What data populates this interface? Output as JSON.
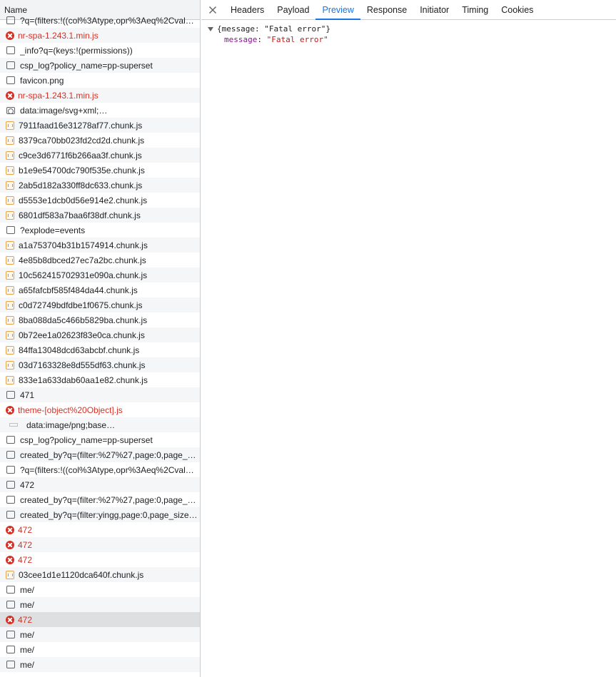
{
  "network": {
    "name_header": "Name",
    "rows": [
      {
        "label": "?q=(filters:!((col%3Atype,opr%3Aeq%2Cval…",
        "icon": "doc",
        "state": "normal"
      },
      {
        "label": "nr-spa-1.243.1.min.js",
        "icon": "err",
        "state": "error"
      },
      {
        "label": "_info?q=(keys:!(permissions))",
        "icon": "doc",
        "state": "normal"
      },
      {
        "label": "csp_log?policy_name=pp-superset",
        "icon": "doc",
        "state": "normal"
      },
      {
        "label": "favicon.png",
        "icon": "doc",
        "state": "normal"
      },
      {
        "label": "nr-spa-1.243.1.min.js",
        "icon": "err",
        "state": "error"
      },
      {
        "label": "data:image/svg+xml;…",
        "icon": "svg",
        "state": "normal"
      },
      {
        "label": "7911faad16e31278af77.chunk.js",
        "icon": "js",
        "state": "normal"
      },
      {
        "label": "8379ca70bb023fd2cd2d.chunk.js",
        "icon": "js",
        "state": "normal"
      },
      {
        "label": "c9ce3d6771f6b266aa3f.chunk.js",
        "icon": "js",
        "state": "normal"
      },
      {
        "label": "b1e9e54700dc790f535e.chunk.js",
        "icon": "js",
        "state": "normal"
      },
      {
        "label": "2ab5d182a330ff8dc633.chunk.js",
        "icon": "js",
        "state": "normal"
      },
      {
        "label": "d5553e1dcb0d56e914e2.chunk.js",
        "icon": "js",
        "state": "normal"
      },
      {
        "label": "6801df583a7baa6f38df.chunk.js",
        "icon": "js",
        "state": "normal"
      },
      {
        "label": "?explode=events",
        "icon": "doc",
        "state": "normal"
      },
      {
        "label": "a1a753704b31b1574914.chunk.js",
        "icon": "js",
        "state": "normal"
      },
      {
        "label": "4e85b8dbced27ec7a2bc.chunk.js",
        "icon": "js",
        "state": "normal"
      },
      {
        "label": "10c562415702931e090a.chunk.js",
        "icon": "js",
        "state": "normal"
      },
      {
        "label": "a65fafcbf585f484da44.chunk.js",
        "icon": "js",
        "state": "normal"
      },
      {
        "label": "c0d72749bdfdbe1f0675.chunk.js",
        "icon": "js",
        "state": "normal"
      },
      {
        "label": "8ba088da5c466b5829ba.chunk.js",
        "icon": "js",
        "state": "normal"
      },
      {
        "label": "0b72ee1a02623f83e0ca.chunk.js",
        "icon": "js",
        "state": "normal"
      },
      {
        "label": "84ffa13048dcd63abcbf.chunk.js",
        "icon": "js",
        "state": "normal"
      },
      {
        "label": "03d7163328e8d555df63.chunk.js",
        "icon": "js",
        "state": "normal"
      },
      {
        "label": "833e1a633dab60aa1e82.chunk.js",
        "icon": "js",
        "state": "normal"
      },
      {
        "label": "471",
        "icon": "doc",
        "state": "normal"
      },
      {
        "label": "theme-[object%20Object].js",
        "icon": "err",
        "state": "error"
      },
      {
        "label": "data:image/png;base…",
        "icon": "img",
        "state": "normal"
      },
      {
        "label": "csp_log?policy_name=pp-superset",
        "icon": "doc",
        "state": "normal"
      },
      {
        "label": "created_by?q=(filter:%27%27,page:0,page_…",
        "icon": "doc",
        "state": "normal"
      },
      {
        "label": "?q=(filters:!((col%3Atype,opr%3Aeq%2Cval…",
        "icon": "doc",
        "state": "normal"
      },
      {
        "label": "472",
        "icon": "doc",
        "state": "normal"
      },
      {
        "label": "created_by?q=(filter:%27%27,page:0,page_…",
        "icon": "doc",
        "state": "normal"
      },
      {
        "label": "created_by?q=(filter:yingg,page:0,page_size…",
        "icon": "doc",
        "state": "normal"
      },
      {
        "label": "472",
        "icon": "err",
        "state": "error"
      },
      {
        "label": "472",
        "icon": "err",
        "state": "error"
      },
      {
        "label": "472",
        "icon": "err",
        "state": "error"
      },
      {
        "label": "03cee1d1e1120dca640f.chunk.js",
        "icon": "js",
        "state": "normal"
      },
      {
        "label": "me/",
        "icon": "doc",
        "state": "normal"
      },
      {
        "label": "me/",
        "icon": "doc",
        "state": "normal"
      },
      {
        "label": "472",
        "icon": "err",
        "state": "error",
        "selected": true
      },
      {
        "label": "me/",
        "icon": "doc",
        "state": "normal"
      },
      {
        "label": "me/",
        "icon": "doc",
        "state": "normal"
      },
      {
        "label": "me/",
        "icon": "doc",
        "state": "normal"
      }
    ]
  },
  "details": {
    "tabs": [
      {
        "label": "Headers"
      },
      {
        "label": "Payload"
      },
      {
        "label": "Preview",
        "active": true
      },
      {
        "label": "Response"
      },
      {
        "label": "Initiator"
      },
      {
        "label": "Timing"
      },
      {
        "label": "Cookies"
      }
    ],
    "preview": {
      "summary": "{message: \"Fatal error\"}",
      "key": "message",
      "separator": ":",
      "value": "\"Fatal error\""
    }
  },
  "colors": {
    "error": "#d93025",
    "accent": "#1a73e8",
    "json_key": "#881391",
    "json_string": "#c41a16"
  }
}
